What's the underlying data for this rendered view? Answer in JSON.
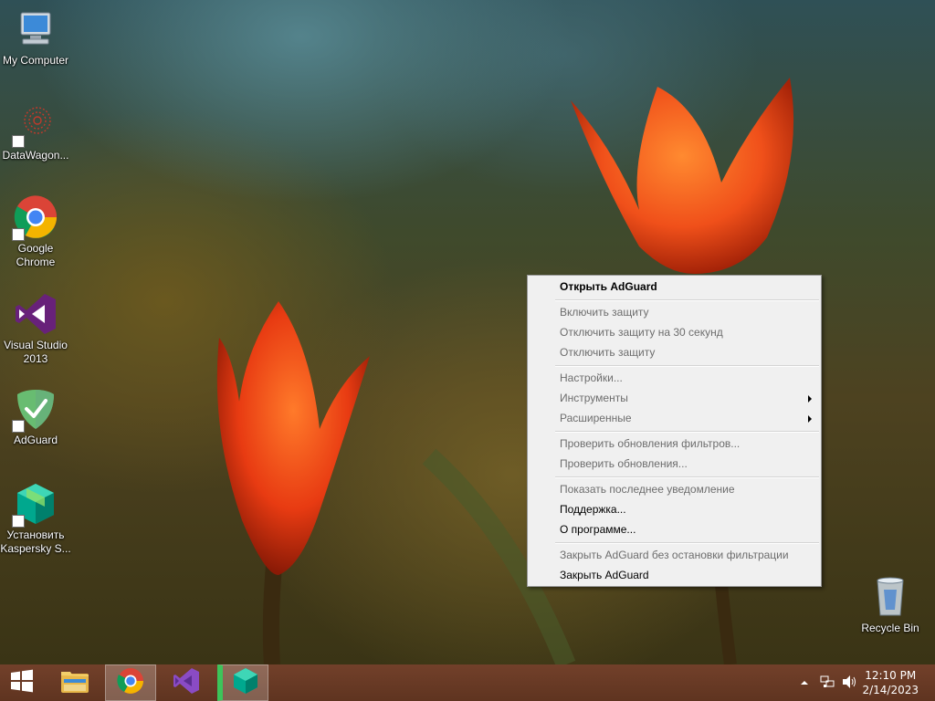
{
  "desktop": {
    "icons": [
      {
        "label": "My Computer",
        "icon": "computer-icon"
      },
      {
        "label": "DataWagon...",
        "icon": "datawagon-icon"
      },
      {
        "label": "Google Chrome",
        "icon": "chrome-icon"
      },
      {
        "label": "Visual Studio 2013",
        "icon": "visual-studio-icon"
      },
      {
        "label": "AdGuard",
        "icon": "adguard-icon"
      },
      {
        "label": "Установить Kaspersky S...",
        "icon": "kaspersky-install-icon"
      },
      {
        "label": "Recycle Bin",
        "icon": "recycle-bin-icon"
      }
    ]
  },
  "context_menu": {
    "items": [
      {
        "label": "Открыть AdGuard",
        "enabled": true,
        "bold": true
      },
      {
        "label": "Включить защиту",
        "enabled": false
      },
      {
        "label": "Отключить защиту на 30 секунд",
        "enabled": false
      },
      {
        "label": "Отключить защиту",
        "enabled": false
      },
      {
        "label": "Настройки...",
        "enabled": false
      },
      {
        "label": "Инструменты",
        "enabled": false,
        "submenu": true
      },
      {
        "label": "Расширенные",
        "enabled": false,
        "submenu": true
      },
      {
        "label": "Проверить обновления фильтров...",
        "enabled": false
      },
      {
        "label": "Проверить обновления...",
        "enabled": false
      },
      {
        "label": "Показать последнее уведомление",
        "enabled": false
      },
      {
        "label": "Поддержка...",
        "enabled": true
      },
      {
        "label": "О программе...",
        "enabled": true
      },
      {
        "label": "Закрыть AdGuard без остановки фильтрации",
        "enabled": false
      },
      {
        "label": "Закрыть AdGuard",
        "enabled": true
      }
    ]
  },
  "taskbar": {
    "pinned": [
      "start-icon",
      "file-explorer-icon",
      "chrome-icon",
      "visual-studio-icon",
      "kaspersky-icon"
    ],
    "clock": {
      "time": "12:10 PM",
      "date": "2/14/2023"
    }
  },
  "colors": {
    "taskbar": "#6a3a25",
    "menu_bg": "#f0f0f0",
    "disabled_text": "#6d6d6d"
  }
}
